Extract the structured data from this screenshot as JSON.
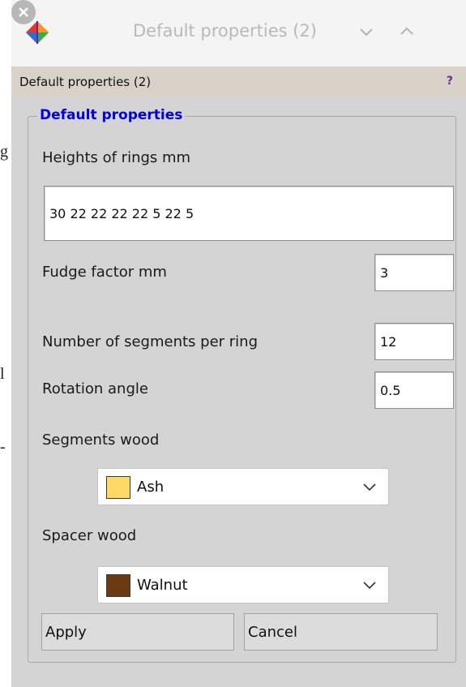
{
  "window": {
    "title": "Default properties (2)",
    "header_title": "Default properties (2)",
    "help_label": "?"
  },
  "background": {
    "glyphs": [
      "g",
      "l",
      "-"
    ]
  },
  "group": {
    "legend": "Default properties"
  },
  "fields": {
    "heights": {
      "label": "Heights of rings mm",
      "value": "30 22 22 22 22 5 22 5"
    },
    "fudge": {
      "label": "Fudge factor mm",
      "value": "3"
    },
    "segments": {
      "label": "Number of segments per ring",
      "value": "12"
    },
    "rotation": {
      "label": "Rotation angle",
      "value": "0.5"
    },
    "segments_wood": {
      "label": "Segments wood",
      "value": "Ash",
      "swatch": "#ffd966"
    },
    "spacer_wood": {
      "label": "Spacer wood",
      "value": "Walnut",
      "swatch": "#6b3a10"
    }
  },
  "buttons": {
    "apply": "Apply",
    "cancel": "Cancel"
  },
  "icons": {
    "app": "freecad-app-icon",
    "minimize": "chevron-down-icon",
    "maximize": "chevron-up-icon",
    "close": "close-icon",
    "help": "help-icon",
    "dropdown": "chevron-down-icon"
  }
}
